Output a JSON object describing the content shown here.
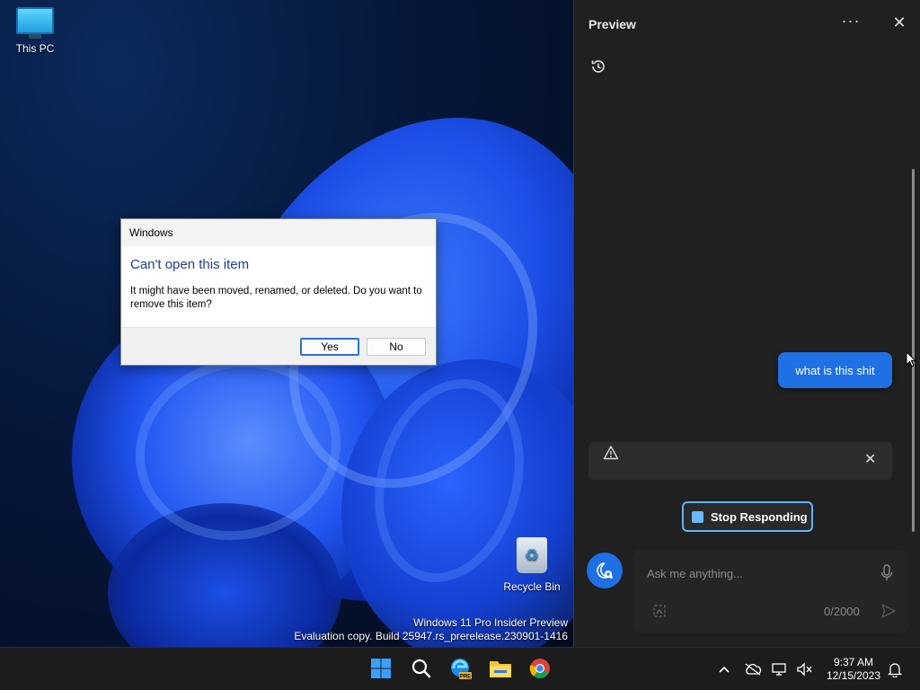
{
  "desktop": {
    "icons": [
      {
        "label": "This PC"
      },
      {
        "label": "Recycle Bin"
      }
    ],
    "watermark": {
      "line1": "Windows 11 Pro Insider Preview",
      "line2": "Evaluation copy. Build 25947.rs_prerelease.230901-1416"
    }
  },
  "dialog": {
    "title": "Windows",
    "heading": "Can't open this item",
    "message": "It might have been moved, renamed, or deleted. Do you want to remove this item?",
    "yes_label": "Yes",
    "no_label": "No"
  },
  "panel": {
    "title": "Preview",
    "more_icon": "more-horizontal-icon",
    "close_icon": "close-icon",
    "history_icon": "history-icon",
    "user_message": "what is this shit",
    "error_icon": "warning-icon",
    "stop_label": "Stop Responding",
    "input_placeholder": "Ask me anything...",
    "char_count": "0/2000",
    "accent_color": "#1f6fe5"
  },
  "taskbar": {
    "apps": [
      "start-icon",
      "search-icon",
      "edge-icon",
      "file-explorer-icon",
      "chrome-icon"
    ],
    "edge_badge": "PRE",
    "time": "9:37 AM",
    "date": "12/15/2023"
  }
}
